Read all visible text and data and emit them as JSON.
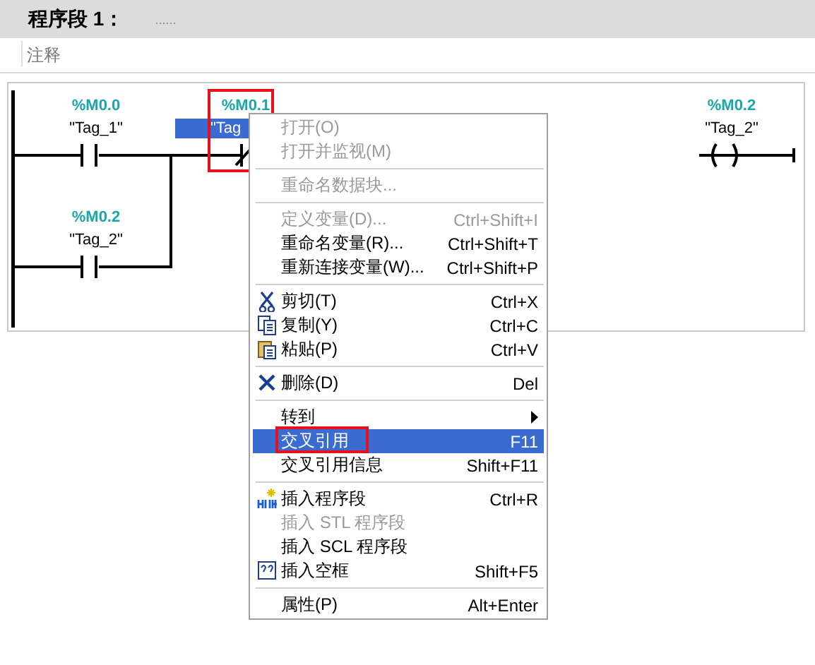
{
  "network": {
    "title": "程序段 1：",
    "title_note": "......",
    "comment": "注释"
  },
  "ladder": {
    "elements": [
      {
        "kind": "no-contact",
        "address": "%M0.0",
        "tag": "\"Tag_1\"",
        "selected": false,
        "highlighted": false
      },
      {
        "kind": "no-contact",
        "address": "%M0.2",
        "tag": "\"Tag_2\"",
        "selected": false,
        "highlighted": false
      },
      {
        "kind": "nc-contact",
        "address": "%M0.1",
        "tag": "\"Tag",
        "selected": true,
        "highlighted": true
      },
      {
        "kind": "coil",
        "address": "%M0.2",
        "tag": "\"Tag_2\"",
        "selected": false,
        "highlighted": false
      }
    ]
  },
  "context_menu": {
    "items": [
      {
        "kind": "item",
        "label": "打开(O)",
        "disabled": true,
        "selected": false,
        "highlighted": false
      },
      {
        "kind": "item",
        "label": "打开并监视(M)",
        "disabled": true,
        "selected": false,
        "highlighted": false
      },
      {
        "kind": "separator"
      },
      {
        "kind": "item",
        "label": "重命名数据块...",
        "disabled": true,
        "selected": false,
        "highlighted": false
      },
      {
        "kind": "separator"
      },
      {
        "kind": "item",
        "label": "定义变量(D)...",
        "shortcut": "Ctrl+Shift+I",
        "disabled": true,
        "selected": false,
        "highlighted": false
      },
      {
        "kind": "item",
        "label": "重命名变量(R)...",
        "shortcut": "Ctrl+Shift+T",
        "disabled": false,
        "selected": false,
        "highlighted": false
      },
      {
        "kind": "item",
        "label": "重新连接变量(W)...",
        "shortcut": "Ctrl+Shift+P",
        "disabled": false,
        "selected": false,
        "highlighted": false
      },
      {
        "kind": "separator"
      },
      {
        "kind": "item",
        "label": "剪切(T)",
        "shortcut": "Ctrl+X",
        "disabled": false,
        "selected": false,
        "highlighted": false
      },
      {
        "kind": "item",
        "label": "复制(Y)",
        "shortcut": "Ctrl+C",
        "disabled": false,
        "selected": false,
        "highlighted": false
      },
      {
        "kind": "item",
        "label": "粘贴(P)",
        "shortcut": "Ctrl+V",
        "disabled": false,
        "selected": false,
        "highlighted": false
      },
      {
        "kind": "separator"
      },
      {
        "kind": "item",
        "label": "删除(D)",
        "shortcut": "Del",
        "disabled": false,
        "selected": false,
        "highlighted": false
      },
      {
        "kind": "separator"
      },
      {
        "kind": "submenu",
        "label": "转到",
        "disabled": false,
        "selected": false,
        "highlighted": false
      },
      {
        "kind": "item",
        "label": "交叉引用",
        "shortcut": "F11",
        "disabled": false,
        "selected": true,
        "highlighted": true
      },
      {
        "kind": "item",
        "label": "交叉引用信息",
        "shortcut": "Shift+F11",
        "disabled": false,
        "selected": false,
        "highlighted": false
      },
      {
        "kind": "separator"
      },
      {
        "kind": "item",
        "label": "插入程序段",
        "shortcut": "Ctrl+R",
        "disabled": false,
        "selected": false,
        "highlighted": false
      },
      {
        "kind": "item",
        "label": "插入 STL 程序段",
        "disabled": true,
        "selected": false,
        "highlighted": false
      },
      {
        "kind": "item",
        "label": "插入 SCL 程序段",
        "disabled": false,
        "selected": false,
        "highlighted": false
      },
      {
        "kind": "item",
        "label": "插入空框",
        "shortcut": "Shift+F5",
        "disabled": false,
        "selected": false,
        "highlighted": false
      },
      {
        "kind": "separator"
      },
      {
        "kind": "item",
        "label": "属性(P)",
        "shortcut": "Alt+Enter",
        "disabled": false,
        "selected": false,
        "highlighted": false
      }
    ]
  }
}
